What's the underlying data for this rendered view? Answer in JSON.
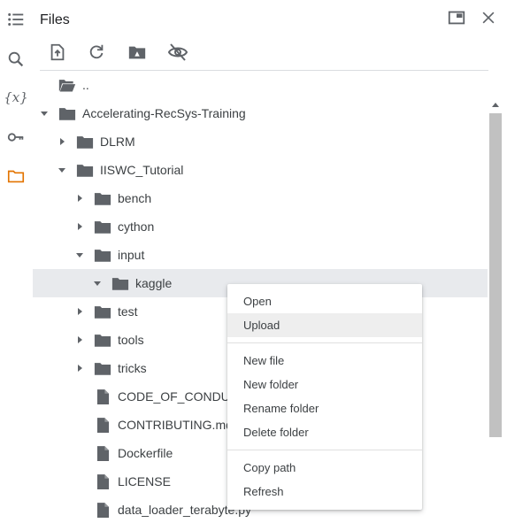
{
  "panel": {
    "title": "Files"
  },
  "rail": {
    "items": [
      {
        "icon": "table-of-contents-icon"
      },
      {
        "icon": "search-icon"
      },
      {
        "icon": "variables-icon",
        "label": "{x}"
      },
      {
        "icon": "key-icon"
      },
      {
        "icon": "folder-icon",
        "active": true
      }
    ]
  },
  "toolbar": {
    "items": [
      "upload-icon",
      "refresh-icon",
      "mount-drive-icon",
      "hide-icon"
    ]
  },
  "tree": {
    "parent": {
      "label": ".."
    },
    "rows": [
      {
        "label": "Accelerating-RecSys-Training",
        "type": "folder",
        "depth": 0,
        "expanded": true
      },
      {
        "label": "DLRM",
        "type": "folder",
        "depth": 1,
        "expanded": false
      },
      {
        "label": "IISWC_Tutorial",
        "type": "folder",
        "depth": 1,
        "expanded": true
      },
      {
        "label": "bench",
        "type": "folder",
        "depth": 2,
        "expanded": false
      },
      {
        "label": "cython",
        "type": "folder",
        "depth": 2,
        "expanded": false
      },
      {
        "label": "input",
        "type": "folder",
        "depth": 2,
        "expanded": true
      },
      {
        "label": "kaggle",
        "type": "folder",
        "depth": 3,
        "expanded": true,
        "selected": true
      },
      {
        "label": "test",
        "type": "folder",
        "depth": 2,
        "expanded": false
      },
      {
        "label": "tools",
        "type": "folder",
        "depth": 2,
        "expanded": false
      },
      {
        "label": "tricks",
        "type": "folder",
        "depth": 2,
        "expanded": false
      },
      {
        "label": "CODE_OF_CONDUCT.md",
        "type": "file",
        "depth": 2
      },
      {
        "label": "CONTRIBUTING.md",
        "type": "file",
        "depth": 2
      },
      {
        "label": "Dockerfile",
        "type": "file",
        "depth": 2
      },
      {
        "label": "LICENSE",
        "type": "file",
        "depth": 2
      },
      {
        "label": "data_loader_terabyte.py",
        "type": "file",
        "depth": 2
      }
    ]
  },
  "context_menu": {
    "groups": [
      [
        "Open",
        "Upload"
      ],
      [
        "New file",
        "New folder",
        "Rename folder",
        "Delete folder"
      ],
      [
        "Copy path",
        "Refresh"
      ]
    ],
    "hovered": "Upload"
  }
}
